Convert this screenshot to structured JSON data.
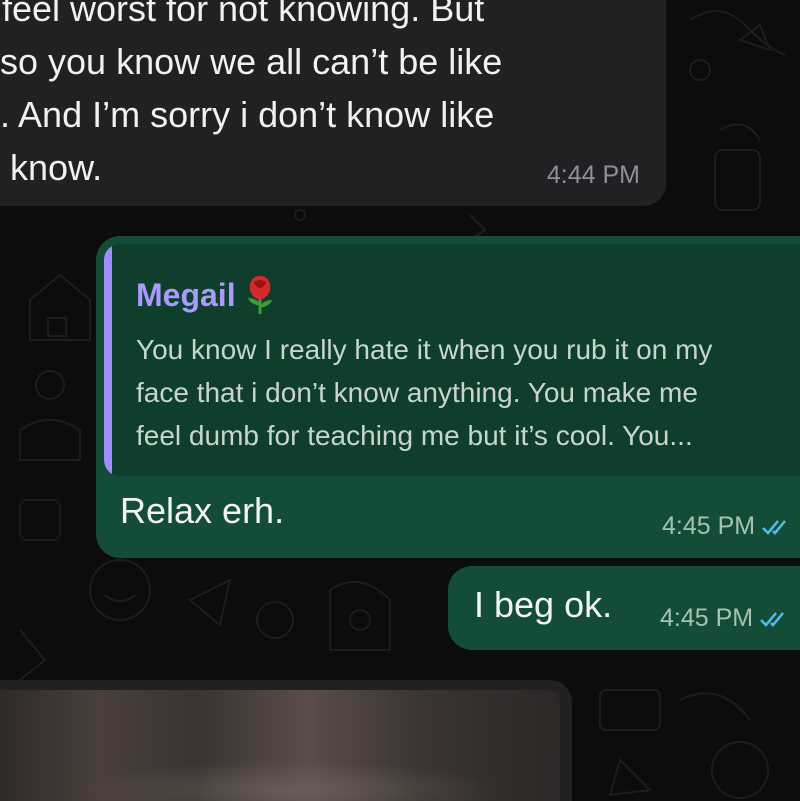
{
  "messages": {
    "incoming": {
      "text": "- feel worst for not knowing. But\nt so you know we all can’t be like\nu. And I’m sorry i don’t know like\nu know.",
      "time": "4:44 PM"
    },
    "reply_message": {
      "quoted_author": "Megail",
      "quoted_author_icon": "rose-icon",
      "quoted_text": "You know I really hate it when you rub it on my\nface that i don’t know anything. You make me\nfeel dumb for teaching me but it’s cool. You...",
      "text": "Relax erh.",
      "time": "4:45 PM",
      "status_icon": "double-check-icon"
    },
    "short_message": {
      "text": "I beg ok.",
      "time": "4:45 PM",
      "status_icon": "double-check-icon"
    },
    "media_preview": {
      "kind": "blurred-image"
    }
  },
  "colors": {
    "background": "#0c0c0c",
    "incoming_bubble": "#1f2123",
    "outgoing_bubble": "#134d37",
    "reply_box": "#0f3f2c",
    "reply_accent": "#a08dff",
    "read_check": "#53bdeb"
  }
}
